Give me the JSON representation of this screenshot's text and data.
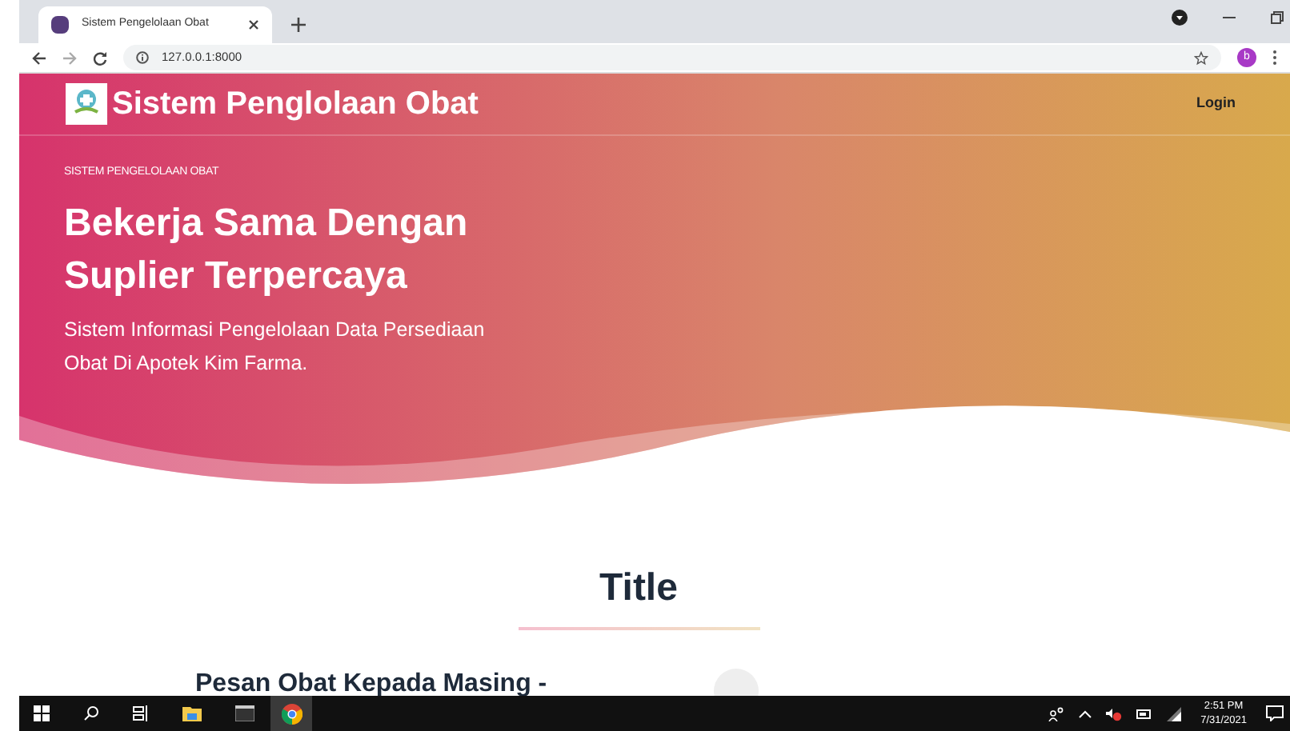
{
  "browser": {
    "tab_title": "Sistem Pengelolaan Obat",
    "url": "127.0.0.1:8000",
    "profile_initial": "b"
  },
  "navbar": {
    "brand": "Sistem Penglolaan Obat",
    "links": [
      "Login"
    ]
  },
  "hero": {
    "eyebrow": "SISTEM PENGELOLAAN OBAT",
    "heading": "Bekerja Sama Dengan Suplier Terpercaya",
    "description": "Sistem Informasi Pengelolaan Data Persediaan Obat Di Apotek Kim Farma."
  },
  "section": {
    "title": "Title",
    "card_title": "Pesan Obat Kepada Masing -"
  },
  "taskbar": {
    "time": "2:51 PM",
    "date": "7/31/2021"
  }
}
